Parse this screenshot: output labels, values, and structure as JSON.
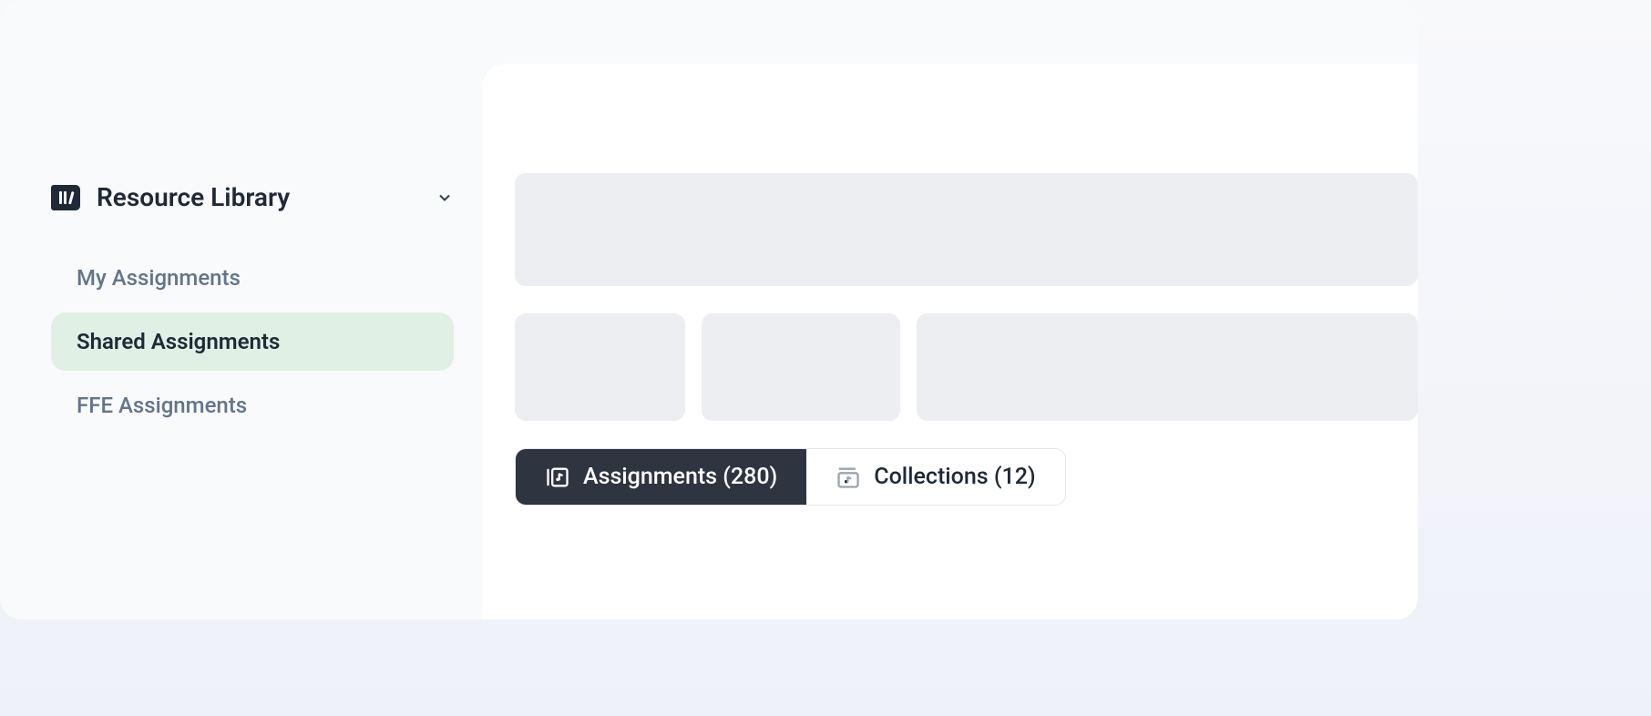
{
  "sidebar": {
    "title": "Resource Library",
    "items": [
      {
        "label": "My Assignments",
        "active": false
      },
      {
        "label": "Shared Assignments",
        "active": true
      },
      {
        "label": "FFE Assignments",
        "active": false
      }
    ]
  },
  "tabs": [
    {
      "label": "Assignments (280)",
      "active": true
    },
    {
      "label": "Collections (12)",
      "active": false
    }
  ]
}
